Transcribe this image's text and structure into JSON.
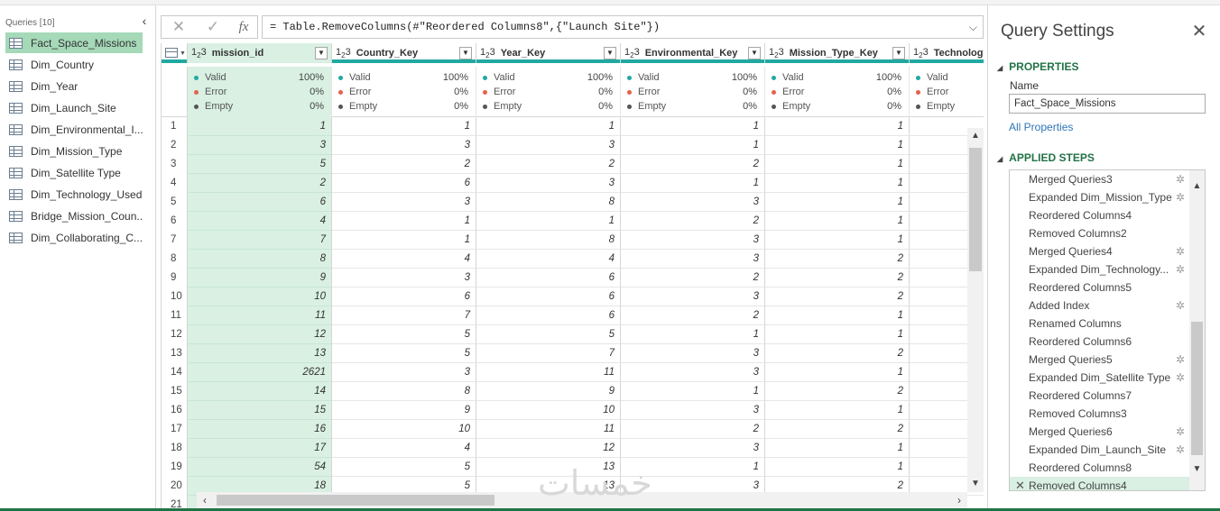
{
  "queries_pane": {
    "header": "Queries [10]",
    "collapse_glyph": "‹",
    "items": [
      {
        "label": "Fact_Space_Missions",
        "selected": true
      },
      {
        "label": "Dim_Country"
      },
      {
        "label": "Dim_Year"
      },
      {
        "label": "Dim_Launch_Site"
      },
      {
        "label": "Dim_Environmental_I..."
      },
      {
        "label": "Dim_Mission_Type"
      },
      {
        "label": "Dim_Satellite Type"
      },
      {
        "label": "Dim_Technology_Used"
      },
      {
        "label": "Bridge_Mission_Coun..."
      },
      {
        "label": "Dim_Collaborating_C..."
      }
    ]
  },
  "formula_bar": {
    "cancel_glyph": "✕",
    "confirm_glyph": "✓",
    "fx_label": "fx",
    "formula": "= Table.RemoveColumns(#\"Reordered Columns8\",{\"Launch Site\"})",
    "expand_glyph": "⌵"
  },
  "grid": {
    "type_icon": "1²3",
    "columns": [
      {
        "name": "mission_id",
        "selected": true
      },
      {
        "name": "Country_Key"
      },
      {
        "name": "Year_Key"
      },
      {
        "name": "Environmental_Key"
      },
      {
        "name": "Mission_Type_Key"
      },
      {
        "name": "Technology_..."
      }
    ],
    "quality_labels": {
      "valid": "Valid",
      "error": "Error",
      "empty": "Empty"
    },
    "quality_values": {
      "valid": "100%",
      "error": "0%",
      "empty": "0%"
    },
    "quality_colors": {
      "valid": "#1fa9a1",
      "error": "#e8604c",
      "empty": "#555555"
    },
    "rows": [
      {
        "n": "1",
        "v": [
          "1",
          "1",
          "1",
          "1",
          "1"
        ]
      },
      {
        "n": "2",
        "v": [
          "3",
          "3",
          "3",
          "1",
          "1"
        ]
      },
      {
        "n": "3",
        "v": [
          "5",
          "2",
          "2",
          "2",
          "1"
        ]
      },
      {
        "n": "4",
        "v": [
          "2",
          "6",
          "3",
          "1",
          "1"
        ]
      },
      {
        "n": "5",
        "v": [
          "6",
          "3",
          "8",
          "3",
          "1"
        ]
      },
      {
        "n": "6",
        "v": [
          "4",
          "1",
          "1",
          "2",
          "1"
        ]
      },
      {
        "n": "7",
        "v": [
          "7",
          "1",
          "8",
          "3",
          "1"
        ]
      },
      {
        "n": "8",
        "v": [
          "8",
          "4",
          "4",
          "3",
          "2"
        ]
      },
      {
        "n": "9",
        "v": [
          "9",
          "3",
          "6",
          "2",
          "2"
        ]
      },
      {
        "n": "10",
        "v": [
          "10",
          "6",
          "6",
          "3",
          "2"
        ]
      },
      {
        "n": "11",
        "v": [
          "11",
          "7",
          "6",
          "2",
          "1"
        ]
      },
      {
        "n": "12",
        "v": [
          "12",
          "5",
          "5",
          "1",
          "1"
        ]
      },
      {
        "n": "13",
        "v": [
          "13",
          "5",
          "7",
          "3",
          "2"
        ]
      },
      {
        "n": "14",
        "v": [
          "2621",
          "3",
          "11",
          "3",
          "1"
        ]
      },
      {
        "n": "15",
        "v": [
          "14",
          "8",
          "9",
          "1",
          "2"
        ]
      },
      {
        "n": "16",
        "v": [
          "15",
          "9",
          "10",
          "3",
          "1"
        ]
      },
      {
        "n": "17",
        "v": [
          "16",
          "10",
          "11",
          "2",
          "2"
        ]
      },
      {
        "n": "18",
        "v": [
          "17",
          "4",
          "12",
          "3",
          "1"
        ]
      },
      {
        "n": "19",
        "v": [
          "54",
          "5",
          "13",
          "1",
          "1"
        ]
      },
      {
        "n": "20",
        "v": [
          "18",
          "5",
          "13",
          "3",
          "2"
        ]
      },
      {
        "n": "21",
        "v": [
          "",
          "",
          "",
          "",
          ""
        ]
      }
    ]
  },
  "query_settings": {
    "title": "Query Settings",
    "close_glyph": "✕",
    "properties_title": "PROPERTIES",
    "name_label": "Name",
    "name_value": "Fact_Space_Missions",
    "all_properties": "All Properties",
    "applied_steps_title": "APPLIED STEPS",
    "steps": [
      {
        "label": "Merged Queries3",
        "gear": true
      },
      {
        "label": "Expanded Dim_Mission_Type",
        "gear": true
      },
      {
        "label": "Reordered Columns4"
      },
      {
        "label": "Removed Columns2"
      },
      {
        "label": "Merged Queries4",
        "gear": true
      },
      {
        "label": "Expanded Dim_Technology...",
        "gear": true
      },
      {
        "label": "Reordered Columns5"
      },
      {
        "label": "Added Index",
        "gear": true
      },
      {
        "label": "Renamed Columns"
      },
      {
        "label": "Reordered Columns6"
      },
      {
        "label": "Merged Queries5",
        "gear": true
      },
      {
        "label": "Expanded Dim_Satellite Type",
        "gear": true
      },
      {
        "label": "Reordered Columns7"
      },
      {
        "label": "Removed Columns3"
      },
      {
        "label": "Merged Queries6",
        "gear": true
      },
      {
        "label": "Expanded Dim_Launch_Site",
        "gear": true
      },
      {
        "label": "Reordered Columns8"
      },
      {
        "label": "Removed Columns4",
        "active": true
      }
    ]
  },
  "watermark": "خمسات"
}
